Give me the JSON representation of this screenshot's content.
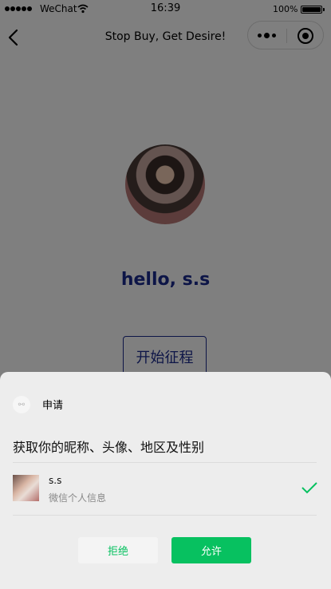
{
  "status_bar": {
    "carrier": "WeChat",
    "time": "16:39",
    "battery_percent": "100%",
    "battery_level": 1.0
  },
  "nav": {
    "title": "Stop Buy, Get Desire!",
    "back_icon": "chevron-left-icon",
    "more_icon": "more-dots-icon",
    "close_icon": "target-circle-icon"
  },
  "page": {
    "greeting": "hello, s.s",
    "start_button": "开始征程",
    "accent_color": "#1b2a8e"
  },
  "auth_sheet": {
    "app_label": "申请",
    "request_text": "获取你的昵称、头像、地区及性别",
    "user_name": "s.s",
    "user_desc": "微信个人信息",
    "reject_label": "拒绝",
    "allow_label": "允许",
    "brand_color": "#07c160"
  }
}
